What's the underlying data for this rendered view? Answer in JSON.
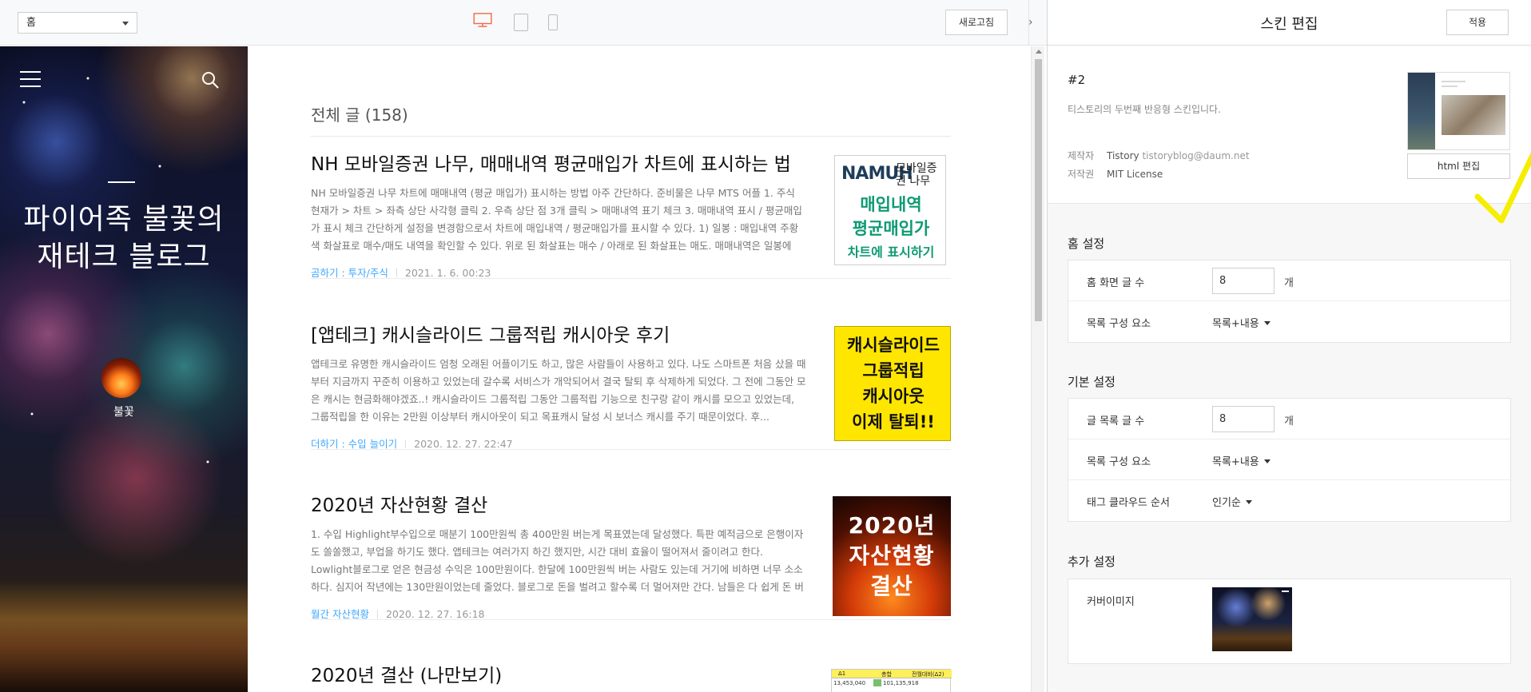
{
  "toolbar": {
    "page_select": "홈",
    "refresh_label": "새로고침",
    "active_device_color": "#f36b4c"
  },
  "blog": {
    "title": "파이어족 불꽃의 재테크 블로그",
    "owner": "불꽃",
    "list_heading": "전체 글 (158)"
  },
  "posts": [
    {
      "title": "NH 모바일증권 나무, 매매내역 평균매입가 차트에 표시하는 법",
      "excerpt": "NH 모바일증권 나무 차트에 매매내역 (평균 매입가) 표시하는 방법 아주 간단하다. 준비물은 나무 MTS 어플 1. 주식 현재가 > 차트 > 좌측 상단 사각형 클릭 2. 우측 상단 점 3개 클릭 > 매매내역 표기 체크 3. 매매내역 표시 / 평균매입가 표시 체크 간단하게 설정을 변경함으로서 차트에 매입내역 / 평균매입가를 표시할 수 있다. 1) 일봉 : 매입내역 주황색 화살표로 매수/매도 내역을 확인할 수 있다. 위로 된 화살표는 매수 / 아래로 된 화살표는 매도. 매매내역은 일봉에서...",
      "category": "곰하기 : 투자/주식",
      "date": "2021. 1. 6. 00:23",
      "thumb_brand": "NAMUH",
      "thumb_sub": "모바일증권 나무",
      "thumb_lines": [
        "매입내역",
        "평균매입가",
        "차트에 표시하기"
      ]
    },
    {
      "title": "[앱테크] 캐시슬라이드 그룹적립 캐시아웃 후기",
      "excerpt": "앱테크로 유명한 캐시슬라이드 엄청 오래된 어플이기도 하고, 많은 사람들이 사용하고 있다. 나도 스마트폰 처음 샀을 때부터 지금까지 꾸준히 이용하고 있었는데 갈수록 서비스가 개악되어서 결국 탈퇴 후 삭제하게 되었다. 그 전에 그동안 모은 캐시는 현금화해야겠죠..! 캐시슬라이드 그룹적립 그동안 그룹적립 기능으로 친구랑 같이 캐시를 모으고 있었는데, 그룹적립을 한 이유는 2만원 이상부터 캐시아웃이 되고 목표캐시 달성 시 보너스 캐시를 주기 때문이었다. 후...",
      "category": "더하기 : 수입 늘이기",
      "date": "2020. 12. 27. 22:47",
      "thumb_lines": [
        "캐시슬라이드",
        "그룹적립",
        "캐시아웃",
        "이제 탈퇴!!"
      ]
    },
    {
      "title": "2020년 자산현황 결산",
      "excerpt": "1. 수입 Highlight부수입으로 매분기 100만원씩 총 400만원 버는게 목표였는데 달성했다. 특판 예적금으로 은행이자도 쏠쏠했고, 부업을 하기도 했다. 앱테크는 여러가지 하긴 했지만, 시간 대비 효율이 떨어져서 줄이려고 한다. Lowlight블로그로 얻은 현금성 수익은 100만원이다. 한달에 100만원씩 버는 사람도 있는데 거기에 비하면 너무 소소하다. 심지어 작년에는 130만원이었는데 줄었다. 블로그로 돈을 벌려고 할수록 더 멀어져만 간다. 남들은 다 쉽게 돈 버는 거 ...",
      "category": "월간 자산현황",
      "date": "2020. 12. 27. 16:18",
      "thumb_lines": [
        "2020년",
        "자산현황",
        "결산"
      ]
    },
    {
      "title": "2020년 결산 (나만보기)",
      "thumb_headers": [
        "Δ1",
        "총합",
        "전월대비(Δ2)"
      ],
      "thumb_values": [
        "13,453,040",
        "101,135,918",
        ""
      ]
    }
  ],
  "panel": {
    "title": "스킨 편집",
    "apply_label": "적용",
    "skin_name": "#2",
    "skin_desc": "티스토리의 두번째 반응형 스킨입니다.",
    "maker_label": "제작자",
    "maker_name": "Tistory",
    "maker_email": "tistoryblog@daum.net",
    "license_label": "저작권",
    "license_value": "MIT License",
    "html_edit_label": "html 편집",
    "highlight_color": "#f5ee00"
  },
  "home_settings": {
    "section": "홈 설정",
    "post_count_label": "홈 화면 글 수",
    "post_count_value": "8",
    "unit": "개",
    "list_element_label": "목록 구성 요소",
    "list_element_value": "목록+내용"
  },
  "basic_settings": {
    "section": "기본 설정",
    "list_count_label": "글 목록 글 수",
    "list_count_value": "8",
    "unit": "개",
    "list_element_label": "목록 구성 요소",
    "list_element_value": "목록+내용",
    "tag_order_label": "태그 클라우드 순서",
    "tag_order_value": "인기순"
  },
  "extra_settings": {
    "section": "추가 설정",
    "cover_label": "커버이미지"
  }
}
